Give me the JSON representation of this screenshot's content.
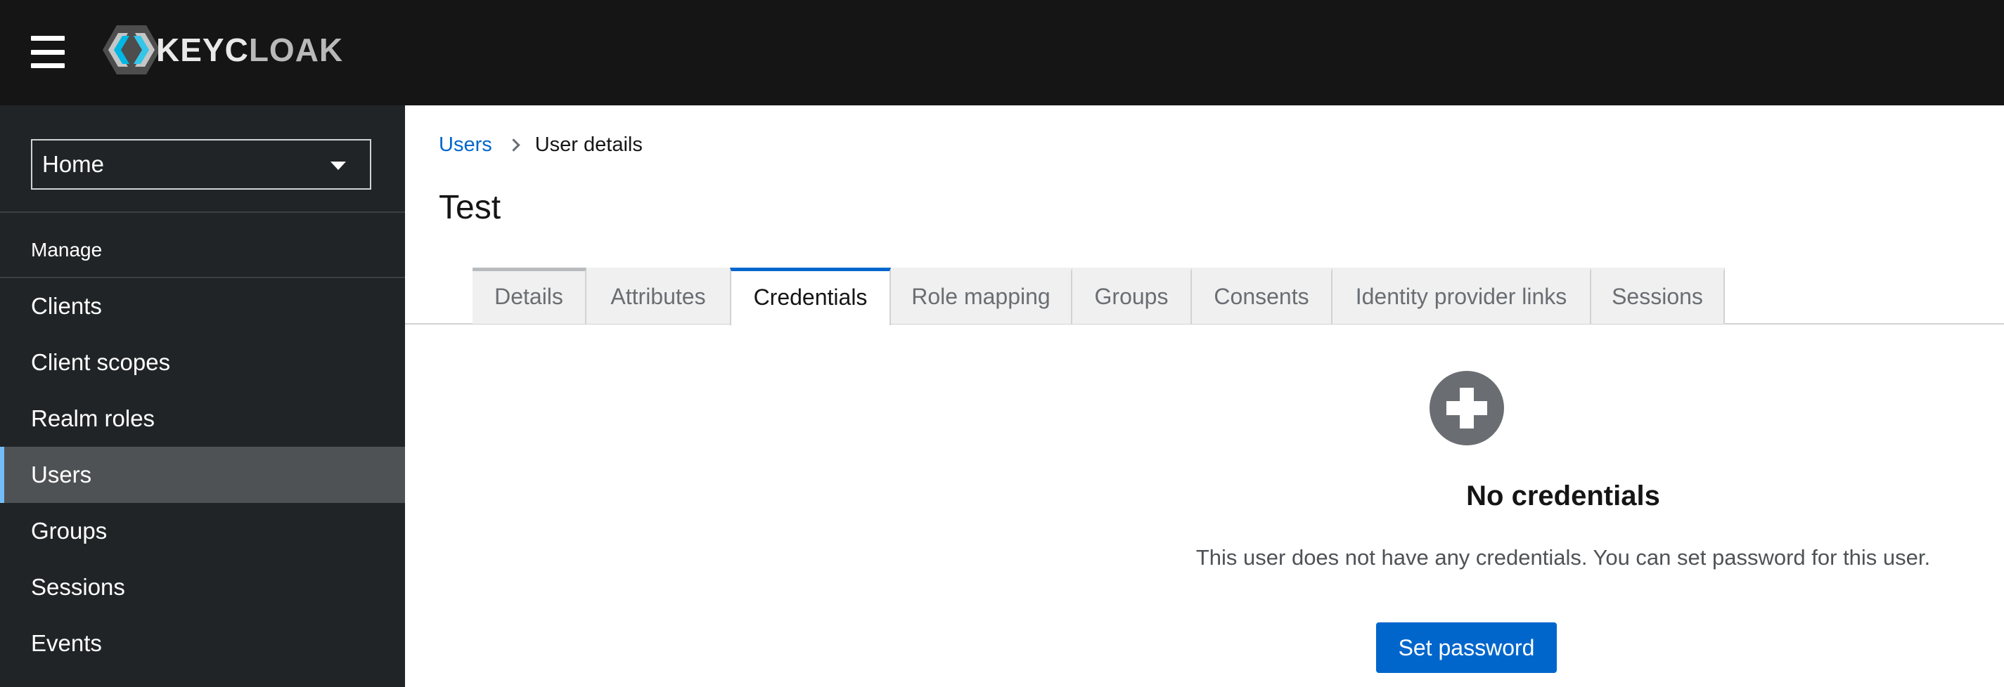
{
  "masthead": {
    "brand": {
      "primary": "KEYC",
      "secondary": "LOAK"
    },
    "menu_icon": "hamburger-icon",
    "logo_icon": "keycloak-hexagon-icon"
  },
  "sidebar": {
    "realm_selector": {
      "value": "Home"
    },
    "section_title": "Manage",
    "items": [
      {
        "label": "Clients",
        "active": false
      },
      {
        "label": "Client scopes",
        "active": false
      },
      {
        "label": "Realm roles",
        "active": false
      },
      {
        "label": "Users",
        "active": true
      },
      {
        "label": "Groups",
        "active": false
      },
      {
        "label": "Sessions",
        "active": false
      },
      {
        "label": "Events",
        "active": false
      }
    ]
  },
  "breadcrumb": {
    "parent": "Users",
    "current": "User details"
  },
  "page": {
    "title": "Test"
  },
  "tabs": [
    {
      "label": "Details",
      "active": false
    },
    {
      "label": "Attributes",
      "active": false
    },
    {
      "label": "Credentials",
      "active": true
    },
    {
      "label": "Role mapping",
      "active": false
    },
    {
      "label": "Groups",
      "active": false
    },
    {
      "label": "Consents",
      "active": false
    },
    {
      "label": "Identity provider links",
      "active": false
    },
    {
      "label": "Sessions",
      "active": false
    }
  ],
  "empty_state": {
    "icon": "plus-circle-icon",
    "title": "No credentials",
    "body": "This user does not have any credentials. You can set password for this user.",
    "action_label": "Set password"
  },
  "colors": {
    "masthead_bg": "#151515",
    "sidebar_bg": "#212427",
    "sidebar_active_bg": "#4f5255",
    "sidebar_active_accent": "#73bcf7",
    "primary": "#0066cc",
    "link": "#0066cc"
  }
}
